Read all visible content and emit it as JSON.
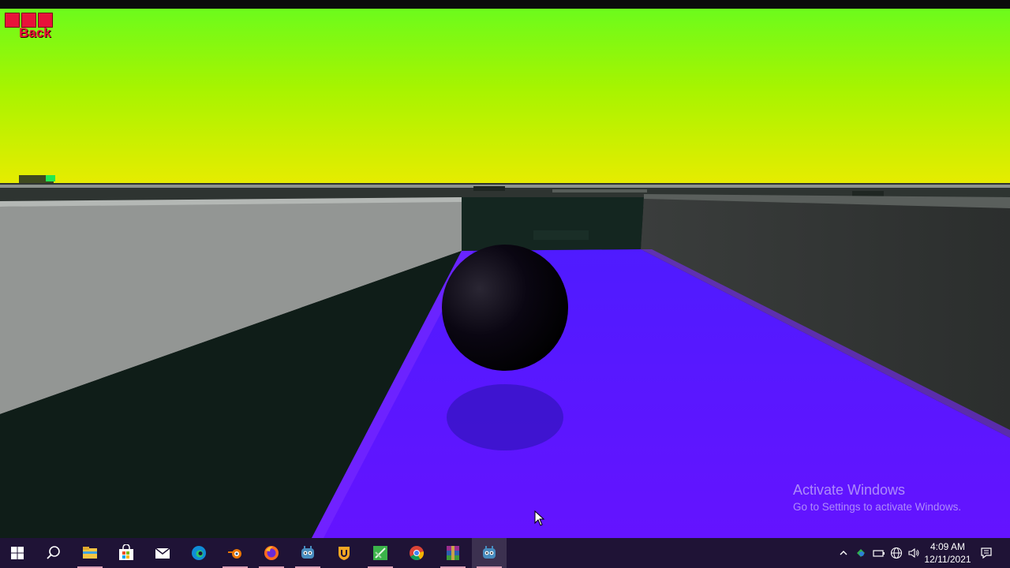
{
  "game": {
    "back_label": "Back",
    "sky_colors": [
      "#6cfb1c",
      "#a7f400",
      "#e8ec00"
    ],
    "floor_color": "#5a10ff",
    "ball_color": "#0a0612"
  },
  "watermark": {
    "title": "Activate Windows",
    "subtitle": "Go to Settings to activate Windows."
  },
  "taskbar": {
    "background": "#1f1336",
    "apps": [
      {
        "name": "file-explorer-icon",
        "running": true
      },
      {
        "name": "microsoft-store-icon",
        "running": false
      },
      {
        "name": "mail-icon",
        "running": false
      },
      {
        "name": "edge-icon",
        "running": false
      },
      {
        "name": "blender-icon",
        "running": true
      },
      {
        "name": "firefox-icon",
        "running": true
      },
      {
        "name": "godot-icon",
        "running": true
      },
      {
        "name": "unity-hub-icon",
        "running": false
      },
      {
        "name": "app-icon-green",
        "running": true
      },
      {
        "name": "chrome-icon",
        "running": false
      },
      {
        "name": "winrar-icon",
        "running": true
      },
      {
        "name": "godot-active-icon",
        "running": true,
        "active": true
      }
    ],
    "clock": {
      "time": "4:09 AM",
      "date": "12/11/2021"
    }
  }
}
